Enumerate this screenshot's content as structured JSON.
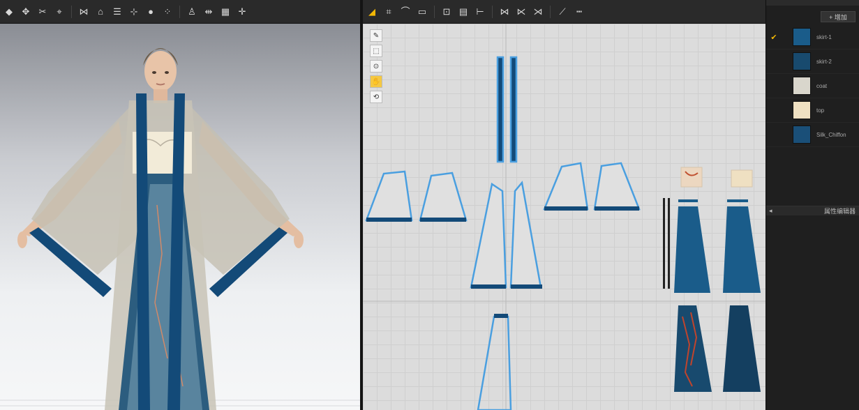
{
  "toolbar_left": {
    "icons": [
      "select-icon",
      "transform-icon",
      "cut-icon",
      "pin-icon",
      "sew-icon",
      "fold-icon",
      "layer-icon",
      "tack-icon",
      "circle-icon",
      "stitch-icon",
      "avatar-icon",
      "measure-icon",
      "grid-icon",
      "move-icon"
    ]
  },
  "toolbar_right": {
    "icons": [
      "edit-pattern-icon",
      "point-icon",
      "curve-icon",
      "rect-icon",
      "internal-icon",
      "pattern-icon",
      "segment-icon",
      "seam-icon",
      "free-sew-icon",
      "tape-icon",
      "line-icon",
      "ruler-icon"
    ]
  },
  "side_tools": [
    "pen-icon",
    "select-icon",
    "zoom-icon",
    "pan-icon",
    "reset-icon"
  ],
  "fabric_panel": {
    "add_label": "+ 增加",
    "property_label": "属性编辑器",
    "items": [
      {
        "name": "skirt-1",
        "color": "#1a5c8a",
        "checked": true
      },
      {
        "name": "skirt-2",
        "color": "#184a6e",
        "checked": false
      },
      {
        "name": "coat",
        "color": "#d9d6cc",
        "checked": false
      },
      {
        "name": "top",
        "color": "#efe0c2",
        "checked": false
      },
      {
        "name": "Silk_Chiffon",
        "color": "#1a4f78",
        "checked": false
      }
    ]
  },
  "colors": {
    "navy": "#134a78",
    "sheer": "#c4bfb2",
    "outline": "#4a9fe0"
  }
}
